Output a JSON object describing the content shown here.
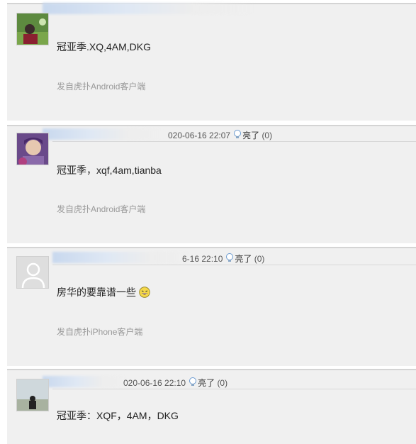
{
  "posts": [
    {
      "date": "",
      "light_label": "",
      "light_count": "",
      "content": "冠亚季.XQ,4AM,DKG",
      "source": "发自虎扑Android客户端",
      "avatar": "photo-avatar"
    },
    {
      "date": "020-06-16 22:07",
      "light_label": "亮了",
      "light_count": "(0)",
      "content": "冠亚季，xqf,4am,tianba",
      "source": "发自虎扑Android客户端",
      "avatar": "anime-avatar"
    },
    {
      "date": "6-16 22:10",
      "light_label": "亮了",
      "light_count": "(0)",
      "content": "房华的要靠谱一些",
      "source": "发自虎扑iPhone客户端",
      "avatar": "default-user-avatar"
    },
    {
      "date": "020-06-16 22:10",
      "light_label": "亮了",
      "light_count": "(0)",
      "content": "冠亚季：XQF，4AM，DKG",
      "source": "",
      "avatar": "photo-avatar"
    }
  ],
  "icons": {
    "light": "lightbulb-icon",
    "emoji": "laughing-emoji-icon"
  },
  "colors": {
    "post_bg": "#f0f0f0",
    "meta_text": "#555555",
    "source_text": "#999999"
  }
}
